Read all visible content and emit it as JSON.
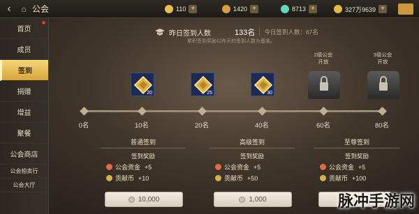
{
  "header": {
    "title": "公会",
    "resources": [
      {
        "name": "gold-icon",
        "value": "110"
      },
      {
        "name": "coin-icon",
        "value": "1420"
      },
      {
        "name": "gem-icon",
        "value": "8713"
      },
      {
        "name": "token-icon",
        "value": "327万9639"
      }
    ]
  },
  "sidebar": {
    "items": [
      {
        "label": "首页"
      },
      {
        "label": "成员"
      },
      {
        "label": "签到"
      },
      {
        "label": "捐赠"
      },
      {
        "label": "增益"
      },
      {
        "label": "聚餐"
      },
      {
        "label": "公会商店"
      },
      {
        "label": "公会拍卖行"
      },
      {
        "label": "公会大厅"
      }
    ]
  },
  "stat": {
    "label": "昨日签到人数",
    "value": "133名",
    "today": "今日签到人数：67名",
    "hint": "累积签到奖励以昨天的签到人数为基准。"
  },
  "milestones": [
    {
      "label": "0名"
    },
    {
      "label": "10名",
      "badge": "20"
    },
    {
      "label": "20名",
      "badge": "25"
    },
    {
      "label": "40名",
      "badge": "30"
    },
    {
      "label": "60名",
      "chest": "2级公会\n开放"
    },
    {
      "label": "80名",
      "chest": "3级公会\n开放"
    }
  ],
  "panels": [
    {
      "title": "普通签到",
      "reward": "签到奖励",
      "items": [
        {
          "name": "公会资金",
          "value": "+5"
        },
        {
          "name": "贡献币",
          "value": "+10"
        }
      ],
      "cost": "10,000"
    },
    {
      "title": "高级签到",
      "reward": "签到奖励",
      "items": [
        {
          "name": "公会资金",
          "value": "+5"
        },
        {
          "name": "贡献币",
          "value": "+50"
        }
      ],
      "cost": "1,000"
    },
    {
      "title": "至尊签到",
      "reward": "签到奖励",
      "items": [
        {
          "name": "公会资金",
          "value": "+5"
        },
        {
          "name": "贡献币",
          "value": "+100"
        }
      ],
      "cost": ""
    }
  ],
  "watermark": "脉冲手游网"
}
